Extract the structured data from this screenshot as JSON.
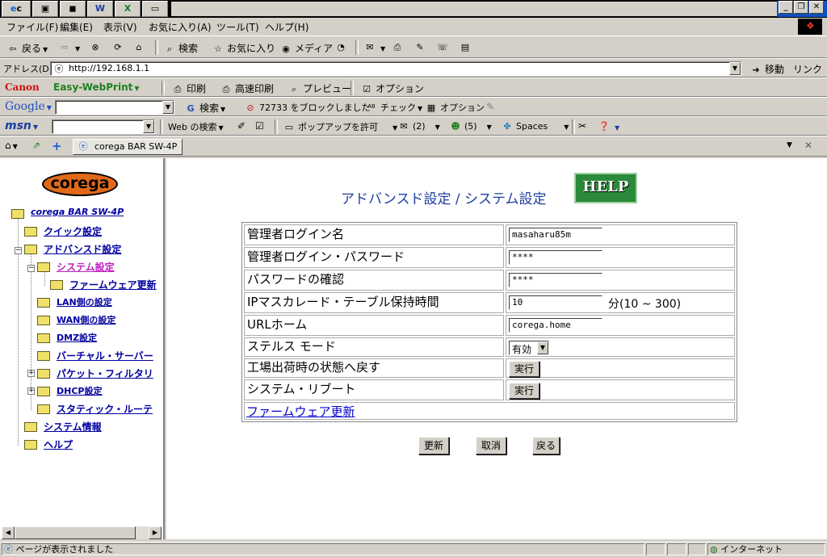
{
  "taskbar": {
    "buttons": [
      "c",
      "",
      "",
      "W",
      "X",
      ""
    ]
  },
  "menubar": {
    "items": [
      "ファイル(F)",
      "編集(E)",
      "表示(V)",
      "お気に入り(A)",
      "ツール(T)",
      "ヘルプ(H)"
    ]
  },
  "standard_toolbar": {
    "back": "戻る",
    "search": "検索",
    "favorites": "お気に入り",
    "media": "メディア"
  },
  "address_bar": {
    "label": "アドレス(D)",
    "url": "http://192.168.1.1",
    "go": "移動",
    "links": "リンク"
  },
  "canon_bar": {
    "brand": "Canon",
    "product": "Easy-WebPrint",
    "print": "印刷",
    "fast_print": "高速印刷",
    "preview": "プレビュー",
    "options": "オプション"
  },
  "google_bar": {
    "brand": "Google",
    "search": "検索",
    "blocked": "72733 をブロックしました",
    "check": "チェック",
    "options": "オプション"
  },
  "msn_bar": {
    "brand": "msn",
    "web_search": "Web の検索",
    "popup": "ポップアップを許可",
    "mail_count": "(2)",
    "messenger_count": "(5)",
    "spaces": "Spaces"
  },
  "tab_bar": {
    "tab_title": "corega BAR SW-4P"
  },
  "left_nav": {
    "logo": "corega",
    "root": "corega BAR SW-4P",
    "items": {
      "quick": "クイック設定",
      "advanced": "アドバンスド設定",
      "system": "システム設定",
      "firmware": "ファームウェア更新",
      "lan": "LAN側の設定",
      "wan": "WAN側の設定",
      "dmz": "DMZ設定",
      "virtual": "バーチャル・サーバー",
      "packet": "パケット・フィルタリ",
      "dhcp": "DHCP設定",
      "static": "スタティック・ルーテ",
      "sysinfo": "システム情報",
      "help": "ヘルプ"
    }
  },
  "main": {
    "title": "アドバンスド設定 / システム設定",
    "help_button": "HELP",
    "rows": {
      "admin_name_label": "管理者ログイン名",
      "admin_name_value": "masaharu85m",
      "admin_pw_label": "管理者ログイン・パスワード",
      "admin_pw_value": "****",
      "pw_confirm_label": "パスワードの確認",
      "pw_confirm_value": "****",
      "ip_masq_label": "IPマスカレード・テーブル保持時間",
      "ip_masq_value": "10",
      "ip_masq_unit": "分(10 ~ 300)",
      "url_home_label": "URLホーム",
      "url_home_value": "corega.home",
      "stealth_label": "ステルス モード",
      "stealth_value": "有効",
      "factory_label": "工場出荷時の状態へ戻す",
      "factory_button": "実行",
      "reboot_label": "システム・リブート",
      "reboot_button": "実行",
      "firmware_link": "ファームウェア更新"
    },
    "buttons": {
      "update": "更新",
      "cancel": "取消",
      "back": "戻る"
    }
  },
  "status_bar": {
    "message": "ページが表示されました",
    "zone": "インターネット"
  }
}
